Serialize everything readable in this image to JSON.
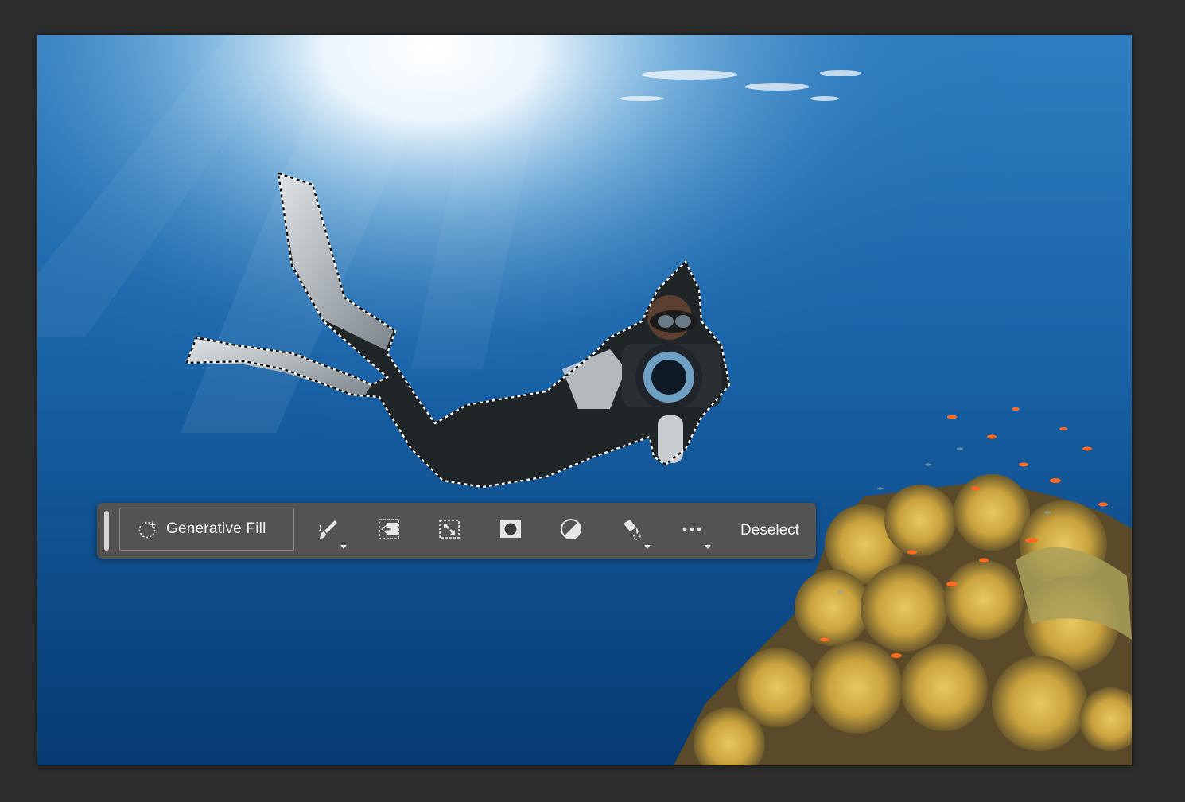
{
  "contextual_taskbar": {
    "generative_fill_label": "Generative Fill",
    "deselect_label": "Deselect"
  },
  "icons": {
    "generative_fill": "sparkle-selection-icon",
    "brush": "brush-icon",
    "modify_selection": "modify-selection-icon",
    "transform": "transform-selection-icon",
    "mask": "mask-icon",
    "invert": "invert-icon",
    "fill": "fill-bucket-icon",
    "more": "more-icon"
  },
  "colors": {
    "app_background": "#2c2c2c",
    "taskbar_background": "#535353",
    "taskbar_text": "#f2f2f2"
  }
}
